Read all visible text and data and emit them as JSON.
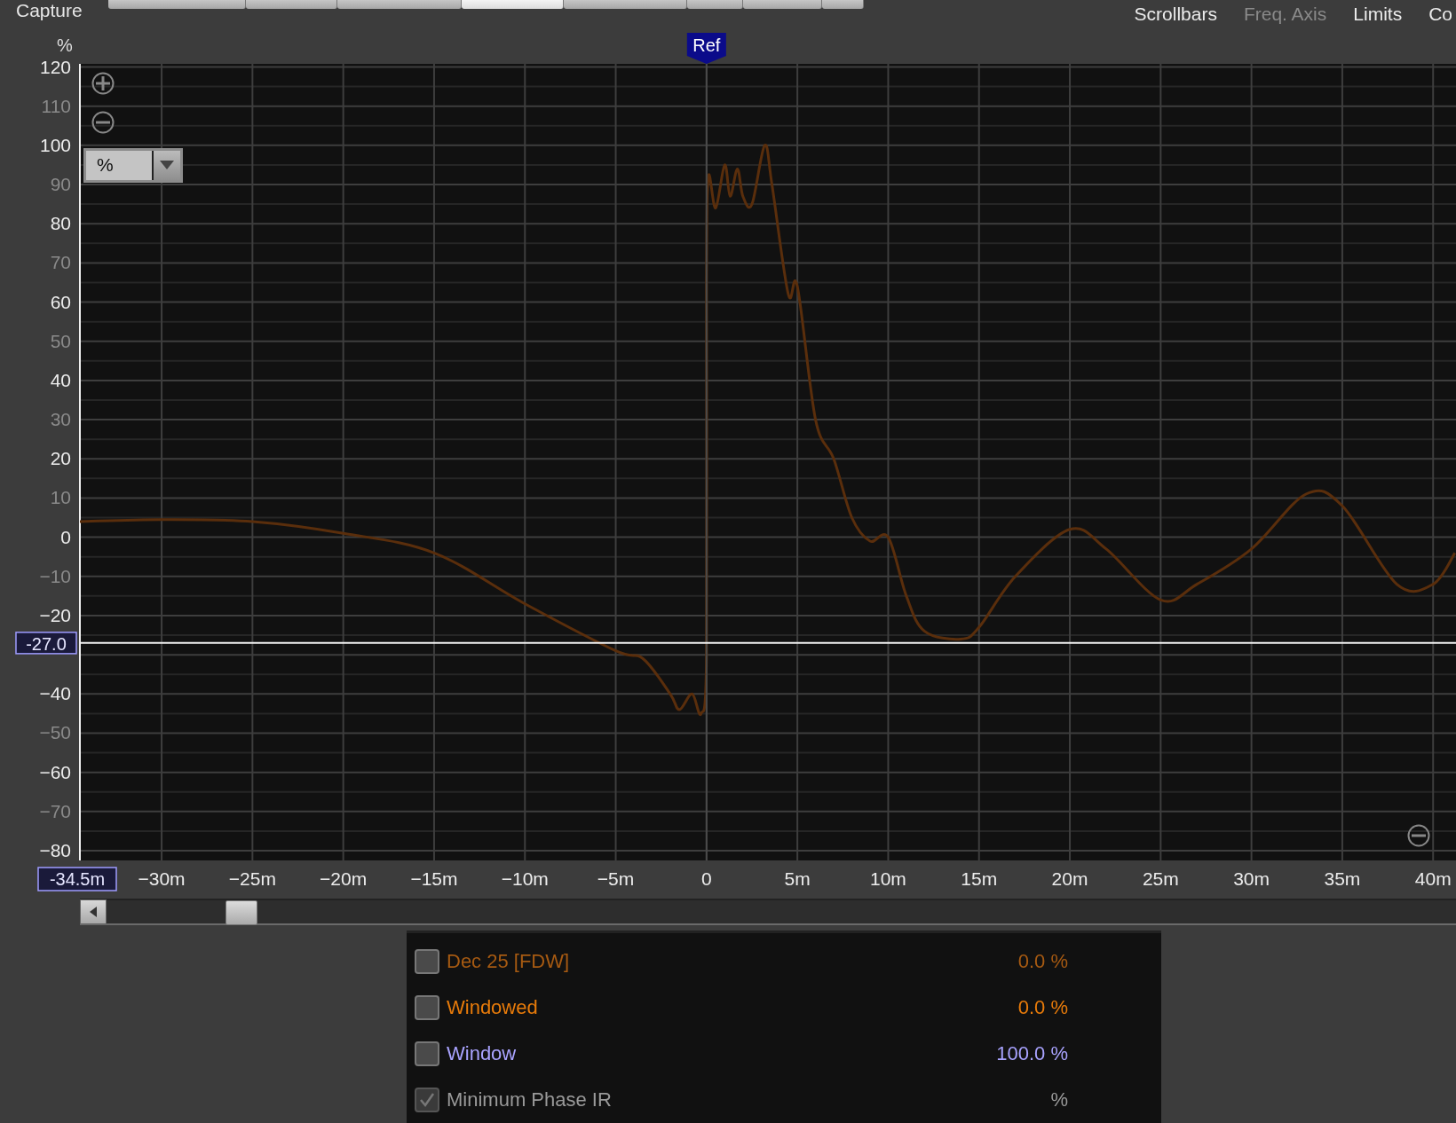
{
  "top_bar": {
    "title": "Capture",
    "toolbar_buttons": [
      {
        "selected": false
      },
      {
        "selected": false
      },
      {
        "selected": false
      },
      {
        "selected": true
      },
      {
        "selected": false
      },
      {
        "selected": false
      },
      {
        "selected": false
      },
      {
        "selected": false
      }
    ],
    "menu": [
      {
        "label": "Scrollbars",
        "disabled": false
      },
      {
        "label": "Freq. Axis",
        "disabled": true
      },
      {
        "label": "Limits",
        "disabled": false
      },
      {
        "label": "Co",
        "disabled": false
      }
    ]
  },
  "graph": {
    "unit_select": {
      "value": "%"
    },
    "chart_data": {
      "type": "line",
      "ylabel": "%",
      "x": [
        -34.5,
        -30,
        -25,
        -20,
        -15,
        -10,
        -5,
        -3.5,
        -2,
        -1.5,
        -0.8,
        -0.3,
        0,
        0,
        0.1,
        0.5,
        1,
        1.3,
        1.7,
        2,
        2.5,
        3.2,
        3.6,
        4.5,
        5,
        6,
        7,
        8,
        9,
        10,
        11,
        12,
        14,
        15,
        17,
        20,
        22,
        25,
        27,
        30,
        33,
        35,
        38,
        40,
        41.2
      ],
      "series": [
        {
          "color": "#5a2e0c",
          "values": [
            4,
            4.5,
            4,
            1,
            -4,
            -17,
            -29,
            -31,
            -40,
            -44,
            -40,
            -45,
            -30,
            65,
            92,
            84,
            95,
            87,
            94,
            87,
            85,
            100,
            90,
            62,
            64,
            30,
            20,
            5,
            -1,
            0,
            -15,
            -24,
            -26,
            -23,
            -10,
            2,
            -3,
            -16,
            -12,
            -3,
            11,
            8,
            -12,
            -12,
            -4
          ]
        }
      ],
      "xlim": [
        -34.5,
        41.26
      ],
      "ylim": [
        -80,
        120
      ],
      "grid": true,
      "xticks": [
        {
          "value": -30,
          "label": "−30m"
        },
        {
          "value": -25,
          "label": "−25m"
        },
        {
          "value": -20,
          "label": "−20m"
        },
        {
          "value": -15,
          "label": "−15m"
        },
        {
          "value": -10,
          "label": "−10m"
        },
        {
          "value": -5,
          "label": "−5m"
        },
        {
          "value": 0,
          "label": "0"
        },
        {
          "value": 5,
          "label": "5m"
        },
        {
          "value": 10,
          "label": "10m"
        },
        {
          "value": 15,
          "label": "15m"
        },
        {
          "value": 20,
          "label": "20m"
        },
        {
          "value": 25,
          "label": "25m"
        },
        {
          "value": 30,
          "label": "30m"
        },
        {
          "value": 35,
          "label": "35m"
        },
        {
          "value": 40,
          "label": "40m"
        }
      ],
      "yticks": [
        {
          "value": 120,
          "label": "120"
        },
        {
          "value": 110,
          "label": "110"
        },
        {
          "value": 100,
          "label": "100"
        },
        {
          "value": 90,
          "label": "90"
        },
        {
          "value": 80,
          "label": "80"
        },
        {
          "value": 70,
          "label": "70"
        },
        {
          "value": 60,
          "label": "60"
        },
        {
          "value": 50,
          "label": "50"
        },
        {
          "value": 40,
          "label": "40"
        },
        {
          "value": 30,
          "label": "30"
        },
        {
          "value": 20,
          "label": "20"
        },
        {
          "value": 10,
          "label": "10"
        },
        {
          "value": 0,
          "label": "0"
        },
        {
          "value": -10,
          "label": "−10"
        },
        {
          "value": -20,
          "label": "−20"
        },
        {
          "value": -40,
          "label": "−40"
        },
        {
          "value": -50,
          "label": "−50"
        },
        {
          "value": -60,
          "label": "−60"
        },
        {
          "value": -70,
          "label": "−70"
        },
        {
          "value": -80,
          "label": "−80"
        }
      ],
      "ref_lines": [
        {
          "axis": "x",
          "value": 0,
          "label": "Ref"
        },
        {
          "axis": "y",
          "value": -27,
          "label": "-27.0"
        }
      ],
      "annotations": [
        "-34.5m"
      ]
    }
  },
  "legend": [
    {
      "label": "Dec 25 [FDW]",
      "value": "0.0 %",
      "color": "#a65a12",
      "checked": false,
      "disabled": false
    },
    {
      "label": "Windowed",
      "value": "0.0 %",
      "color": "#e87b0a",
      "checked": false,
      "disabled": false
    },
    {
      "label": "Window",
      "value": "100.0 %",
      "color": "#a9a3ff",
      "checked": false,
      "disabled": false
    },
    {
      "label": "Minimum Phase IR",
      "value": "%",
      "color": "#9a9a9a",
      "checked": true,
      "disabled": true
    }
  ]
}
